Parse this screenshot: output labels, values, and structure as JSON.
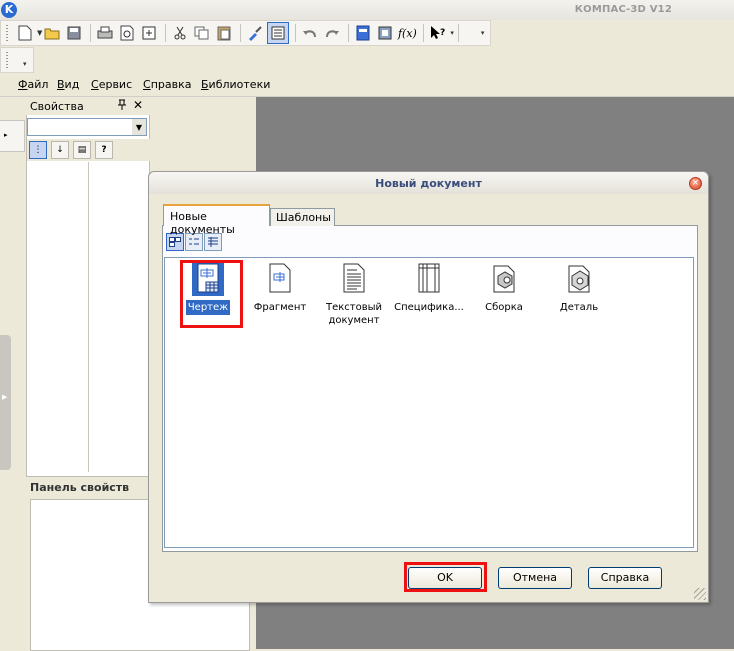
{
  "app": {
    "title": "КОМПАС-3D V12",
    "logo_letter": "K"
  },
  "menubar": {
    "items": [
      "Файл",
      "Вид",
      "Сервис",
      "Справка",
      "Библиотеки"
    ]
  },
  "properties_panel": {
    "title": "Свойства",
    "pin_icon": "pin-icon",
    "close_glyph": "✕"
  },
  "panel_svoistv": {
    "title": "Панель свойств"
  },
  "dialog": {
    "title": "Новый документ",
    "tabs": [
      {
        "label": "Новые документы",
        "active": true
      },
      {
        "label": "Шаблоны",
        "active": false
      }
    ],
    "items": [
      {
        "label": "Чертеж",
        "icon": "drawing-icon",
        "selected": true
      },
      {
        "label": "Фрагмент",
        "icon": "fragment-icon",
        "selected": false
      },
      {
        "label": "Текстовый документ",
        "icon": "text-document-icon",
        "selected": false
      },
      {
        "label": "Специфика...",
        "icon": "specification-icon",
        "selected": false
      },
      {
        "label": "Сборка",
        "icon": "assembly-icon",
        "selected": false
      },
      {
        "label": "Деталь",
        "icon": "part-icon",
        "selected": false
      }
    ],
    "buttons": {
      "ok": "OK",
      "cancel": "Отмена",
      "help": "Справка"
    }
  },
  "colors": {
    "highlight": "#ee1111",
    "selection": "#316ac5",
    "workspace": "#808080"
  }
}
